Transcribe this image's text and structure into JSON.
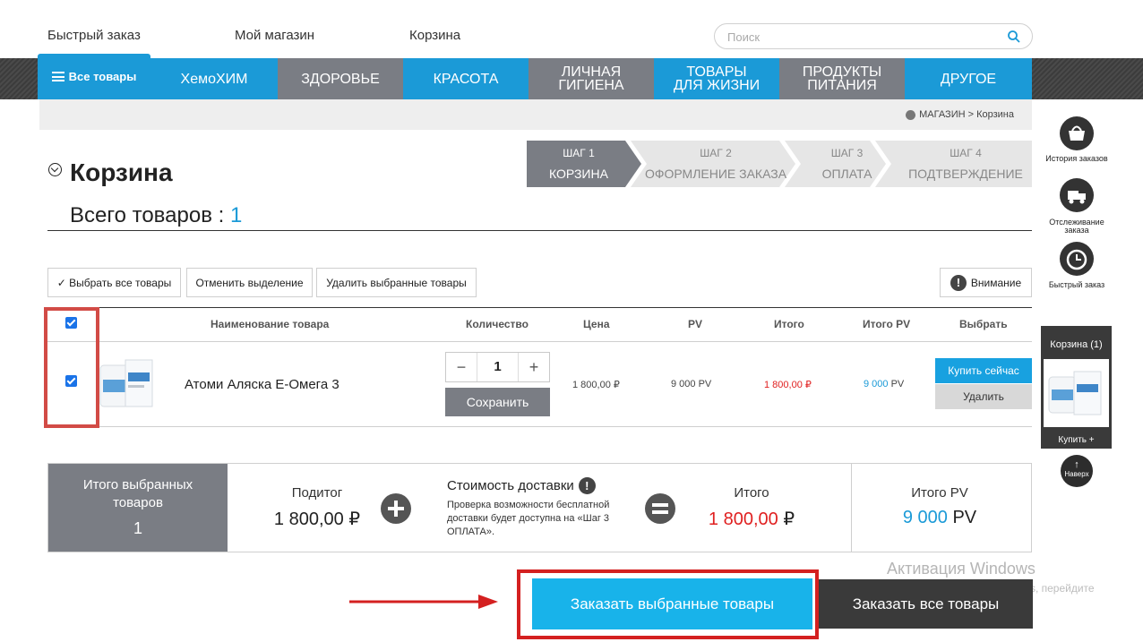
{
  "topnav": {
    "quick_order": "Быстрый заказ",
    "my_shop": "Мой магазин",
    "cart": "Корзина"
  },
  "search": {
    "placeholder": "Поиск"
  },
  "menu": {
    "all": "Все товары",
    "items": [
      "ХемоХИМ",
      "ЗДОРОВЬЕ",
      "КРАСОТА",
      "ЛИЧНАЯ ГИГИЕНА",
      "ТОВАРЫ ДЛЯ ЖИЗНИ",
      "ПРОДУКТЫ ПИТАНИЯ",
      "ДРУГОЕ"
    ],
    "colors": [
      "#1b9ad7",
      "#7a7d84",
      "#1b9ad7",
      "#7a7d84",
      "#1b9ad7",
      "#7a7d84",
      "#1b9ad7"
    ]
  },
  "breadcrumb": "МАГАЗИН > Корзина",
  "page": {
    "title": "Корзина",
    "total_label": "Всего товаров : ",
    "total_count": "1"
  },
  "steps": [
    {
      "num": "ШАГ 1",
      "label": "КОРЗИНА"
    },
    {
      "num": "ШАГ 2",
      "label": "ОФОРМЛЕНИЕ ЗАКАЗА"
    },
    {
      "num": "ШАГ 3",
      "label": "ОПЛАТА"
    },
    {
      "num": "ШАГ 4",
      "label": "ПОДТВЕРЖДЕНИЕ"
    }
  ],
  "actions": {
    "select_all": "✓ Выбрать все товары",
    "deselect": "Отменить выделение",
    "delete_selected": "Удалить выбранные товары",
    "attention": "Внимание"
  },
  "table": {
    "headers": {
      "name": "Наименование товара",
      "qty": "Количество",
      "price": "Цена",
      "pv": "PV",
      "total": "Итого",
      "total_pv": "Итого PV",
      "select": "Выбрать"
    },
    "row": {
      "name": "Атоми Аляска Е-Омега 3",
      "qty": "1",
      "qty_minus": "−",
      "qty_plus": "+",
      "save": "Сохранить",
      "price": "1 800,00 ₽",
      "pv": "9 000 PV",
      "total": "1 800,00 ₽",
      "total_pv_num": "9 000",
      "total_pv_unit": " PV",
      "buy_now": "Купить сейчас",
      "delete": "Удалить"
    }
  },
  "summary": {
    "selected_label": "Итого выбранных товаров",
    "selected_count": "1",
    "subtotal_label": "Подитог",
    "subtotal_value": "1 800,00 ₽",
    "delivery_label": "Стоимость доставки",
    "delivery_note": "Проверка возможности бесплатной доставки будет доступна на «Шаг 3 ОПЛАТА».",
    "total_label": "Итого",
    "total_value": "1 800,00",
    "currency": " ₽",
    "total_pv_label": "Итого PV",
    "total_pv_value": "9 000",
    "pv_unit": " PV"
  },
  "order": {
    "selected": "Заказать выбранные товары",
    "all": "Заказать все товары"
  },
  "watermark": {
    "line1": "Активация Windows",
    "line2": "Чтобы активировать Windows, перейдите"
  },
  "sidebar": {
    "history": "История заказов",
    "tracking": "Отслеживание заказа",
    "quick": "Быстрый заказ",
    "cart": "Корзина (1)",
    "buy_plus": "Купить +",
    "top": "Наверх"
  },
  "colors": {
    "accent": "#1b9ad7",
    "price_red": "#e02020",
    "step_active": "#7a7d84",
    "dark": "#3a3a3a"
  }
}
